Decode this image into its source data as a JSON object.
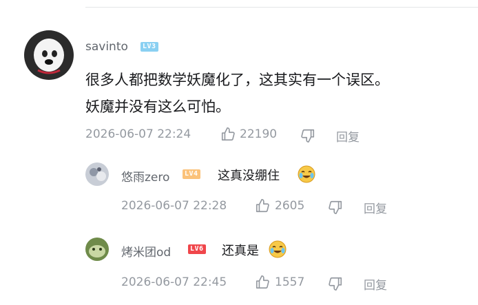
{
  "main_comment": {
    "username": "savinto",
    "level": "LV3",
    "text_line1": "很多人都把数学妖魔化了，这其实有一个误区。",
    "text_line2": "妖魔并没有这么可怕。",
    "timestamp": "2026-06-07 22:24",
    "likes": "22190",
    "reply_label": "回复"
  },
  "replies": [
    {
      "username": "悠雨zero",
      "level": "LV4",
      "text": "这真没绷住",
      "timestamp": "2026-06-07 22:28",
      "likes": "2605",
      "reply_label": "回复"
    },
    {
      "username": "烤米团od",
      "level": "LV6",
      "text": "还真是",
      "timestamp": "2026-06-07 22:45",
      "likes": "1557",
      "reply_label": "回复"
    }
  ],
  "icons": {
    "like": "thumbs-up-icon",
    "dislike": "thumbs-down-icon",
    "emoji": "laughing-crying-emoji"
  },
  "colors": {
    "text": "#18191c",
    "username": "#61666d",
    "meta": "#9499a0",
    "lv3": "#8ad0f2",
    "lv4": "#fbc27a",
    "lv6": "#f0464b"
  }
}
